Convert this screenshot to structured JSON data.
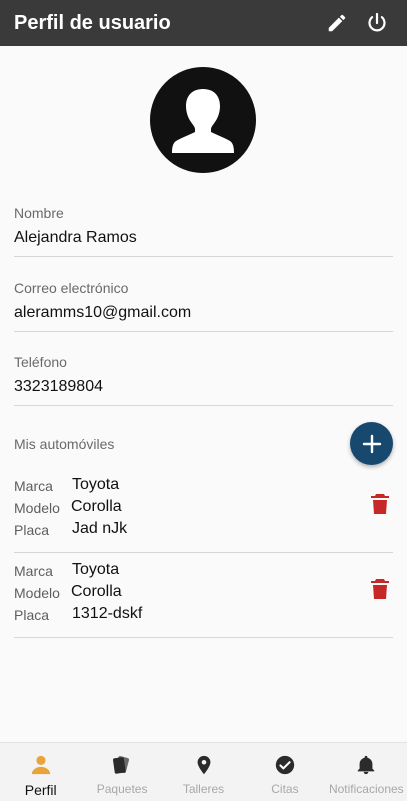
{
  "header": {
    "title": "Perfil de usuario",
    "edit_icon": "pencil-icon",
    "logout_icon": "power-icon"
  },
  "profile": {
    "name_label": "Nombre",
    "name": "Alejandra Ramos",
    "email_label": "Correo electrónico",
    "email": "aleramms10@gmail.com",
    "phone_label": "Teléfono",
    "phone": "3323189804"
  },
  "cars": {
    "title": "Mis automóviles",
    "add_icon": "plus-icon",
    "brand_label": "Marca",
    "model_label": "Modelo",
    "plate_label": "Placa",
    "items": [
      {
        "brand": "Toyota",
        "model": "Corolla",
        "plate": "Jad nJk"
      },
      {
        "brand": "Toyota",
        "model": "Corolla",
        "plate": "1312-dskf"
      }
    ]
  },
  "nav": {
    "items": [
      {
        "label": "Perfil",
        "icon": "person-icon",
        "active": true
      },
      {
        "label": "Paquetes",
        "icon": "cards-icon"
      },
      {
        "label": "Talleres",
        "icon": "map-pin-icon"
      },
      {
        "label": "Citas",
        "icon": "check-circle-icon"
      },
      {
        "label": "Notificaciones",
        "icon": "bell-icon"
      }
    ]
  },
  "colors": {
    "appbar": "#3a3a3a",
    "fab": "#17496f",
    "delete": "#c62828",
    "active_nav": "#e8a33a",
    "inactive_nav": "#a8a8a8"
  }
}
